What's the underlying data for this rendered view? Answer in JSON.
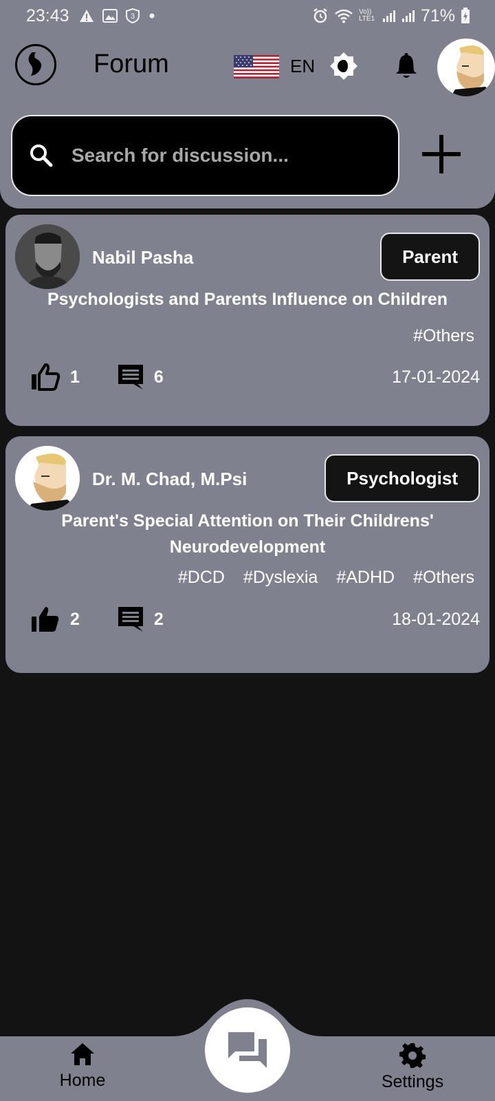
{
  "status_bar": {
    "time": "23:43",
    "battery": "71%",
    "network_label": "Vo)) LTE1"
  },
  "app_bar": {
    "title": "Forum",
    "language": "EN"
  },
  "search": {
    "placeholder": "Search for discussion..."
  },
  "posts": [
    {
      "author": "Nabil Pasha",
      "role": "Parent",
      "title": "Psychologists and Parents Influence on Children",
      "tags": [
        "#Others"
      ],
      "likes": "1",
      "comments": "6",
      "date": "17-01-2024",
      "liked": false
    },
    {
      "author": "Dr. M. Chad, M.Psi",
      "role": "Psychologist",
      "title": "Parent's Special Attention on Their Childrens' Neurodevelopment",
      "tags": [
        "#DCD",
        "#Dyslexia",
        "#ADHD",
        "#Others"
      ],
      "likes": "2",
      "comments": "2",
      "date": "18-01-2024",
      "liked": true
    }
  ],
  "bottom_nav": {
    "home_label": "Home",
    "settings_label": "Settings"
  },
  "colors": {
    "surface": "#80818f",
    "background": "#131313",
    "dark": "#141414",
    "white": "#ffffff"
  }
}
